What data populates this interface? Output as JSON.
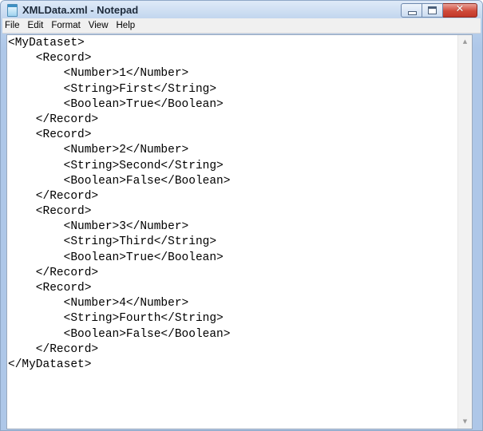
{
  "window": {
    "title": "XMLData.xml - Notepad",
    "icon": "notepad-icon"
  },
  "caption_buttons": {
    "minimize": "▭",
    "maximize": "□",
    "close": "✕"
  },
  "menu": [
    "File",
    "Edit",
    "Format",
    "View",
    "Help"
  ],
  "editor": {
    "lines": [
      "<MyDataset>",
      "    <Record>",
      "        <Number>1</Number>",
      "        <String>First</String>",
      "        <Boolean>True</Boolean>",
      "    </Record>",
      "    <Record>",
      "        <Number>2</Number>",
      "        <String>Second</String>",
      "        <Boolean>False</Boolean>",
      "    </Record>",
      "    <Record>",
      "        <Number>3</Number>",
      "        <String>Third</String>",
      "        <Boolean>True</Boolean>",
      "    </Record>",
      "    <Record>",
      "        <Number>4</Number>",
      "        <String>Fourth</String>",
      "        <Boolean>False</Boolean>",
      "    </Record>",
      "</MyDataset>"
    ]
  },
  "scrollbar": {
    "up_arrow": "▲",
    "down_arrow": "▼"
  }
}
